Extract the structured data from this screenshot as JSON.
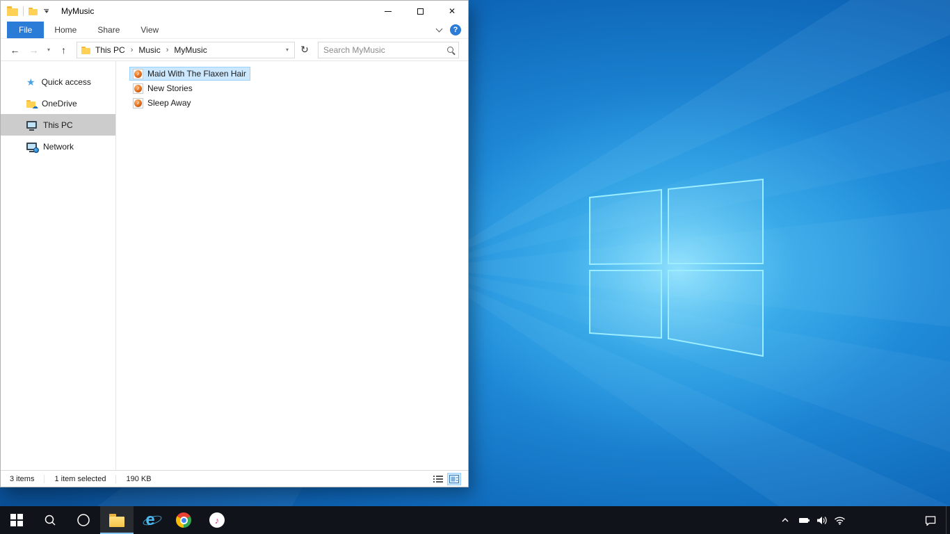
{
  "window": {
    "title": "MyMusic"
  },
  "ribbon": {
    "tabs": [
      "File",
      "Home",
      "Share",
      "View"
    ],
    "help_label": "?"
  },
  "addressbar": {
    "back_glyph": "←",
    "forward_glyph": "→",
    "recent_glyph": "▾",
    "up_glyph": "↑",
    "breadcrumb": [
      "This PC",
      "Music",
      "MyMusic"
    ],
    "separator": "›",
    "dropdown_glyph": "▾",
    "refresh_glyph": "↻",
    "search_placeholder": "Search MyMusic"
  },
  "sidebar": {
    "items": [
      "Quick access",
      "OneDrive",
      "This PC",
      "Network"
    ],
    "selected_item": "This PC"
  },
  "files": {
    "rows": [
      {
        "name": "Maid With The Flaxen Hair",
        "selected": true
      },
      {
        "name": "New Stories",
        "selected": false
      },
      {
        "name": "Sleep Away",
        "selected": false
      }
    ],
    "note_glyph": "♪"
  },
  "statusbar": {
    "count": "3 items",
    "selection": "1 item selected",
    "size": "190 KB"
  },
  "taskbar": {
    "ie_glyph": "e",
    "itunes_glyph": "♪"
  },
  "icons": {
    "quick_access": "star-icon",
    "onedrive": "folder-cloud-icon",
    "this_pc": "monitor-icon",
    "network": "monitor-globe-icon",
    "file_type": "music-file-icon"
  },
  "colors": {
    "accent": "#2b7cd6",
    "selection_bg": "#cce8ff",
    "selection_border": "#99d1ff",
    "sidebar_selected": "#cccccc",
    "taskbar": "#101319"
  }
}
